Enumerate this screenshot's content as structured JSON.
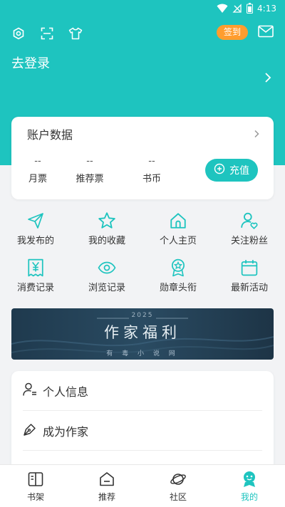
{
  "status": {
    "time": "4:13"
  },
  "header": {
    "checkin_label": "签到",
    "login_label": "去登录"
  },
  "account": {
    "title": "账户数据",
    "stats": [
      {
        "value": "--",
        "label": "月票"
      },
      {
        "value": "--",
        "label": "推荐票"
      },
      {
        "value": "--",
        "label": "书币"
      }
    ],
    "recharge_label": "充值"
  },
  "grid": [
    {
      "label": "我发布的",
      "icon": "paper-plane-icon"
    },
    {
      "label": "我的收藏",
      "icon": "star-icon"
    },
    {
      "label": "个人主页",
      "icon": "home-icon"
    },
    {
      "label": "关注粉丝",
      "icon": "user-heart-icon"
    },
    {
      "label": "消费记录",
      "icon": "yen-receipt-icon"
    },
    {
      "label": "浏览记录",
      "icon": "eye-icon"
    },
    {
      "label": "勋章头衔",
      "icon": "medal-icon"
    },
    {
      "label": "最新活动",
      "icon": "calendar-icon"
    }
  ],
  "banner": {
    "year": "2025",
    "title": "作家福利",
    "subtitle": "有 毒 小 说 网"
  },
  "menu": [
    {
      "label": "个人信息",
      "icon": "user-info-icon"
    },
    {
      "label": "成为作家",
      "icon": "pen-nib-icon"
    }
  ],
  "tabs": [
    {
      "label": "书架",
      "icon": "bookshelf-icon"
    },
    {
      "label": "推荐",
      "icon": "recommend-icon"
    },
    {
      "label": "社区",
      "icon": "planet-icon"
    },
    {
      "label": "我的",
      "icon": "mine-icon"
    }
  ],
  "colors": {
    "accent": "#1ec4bf",
    "checkin": "#ff9d2e"
  }
}
